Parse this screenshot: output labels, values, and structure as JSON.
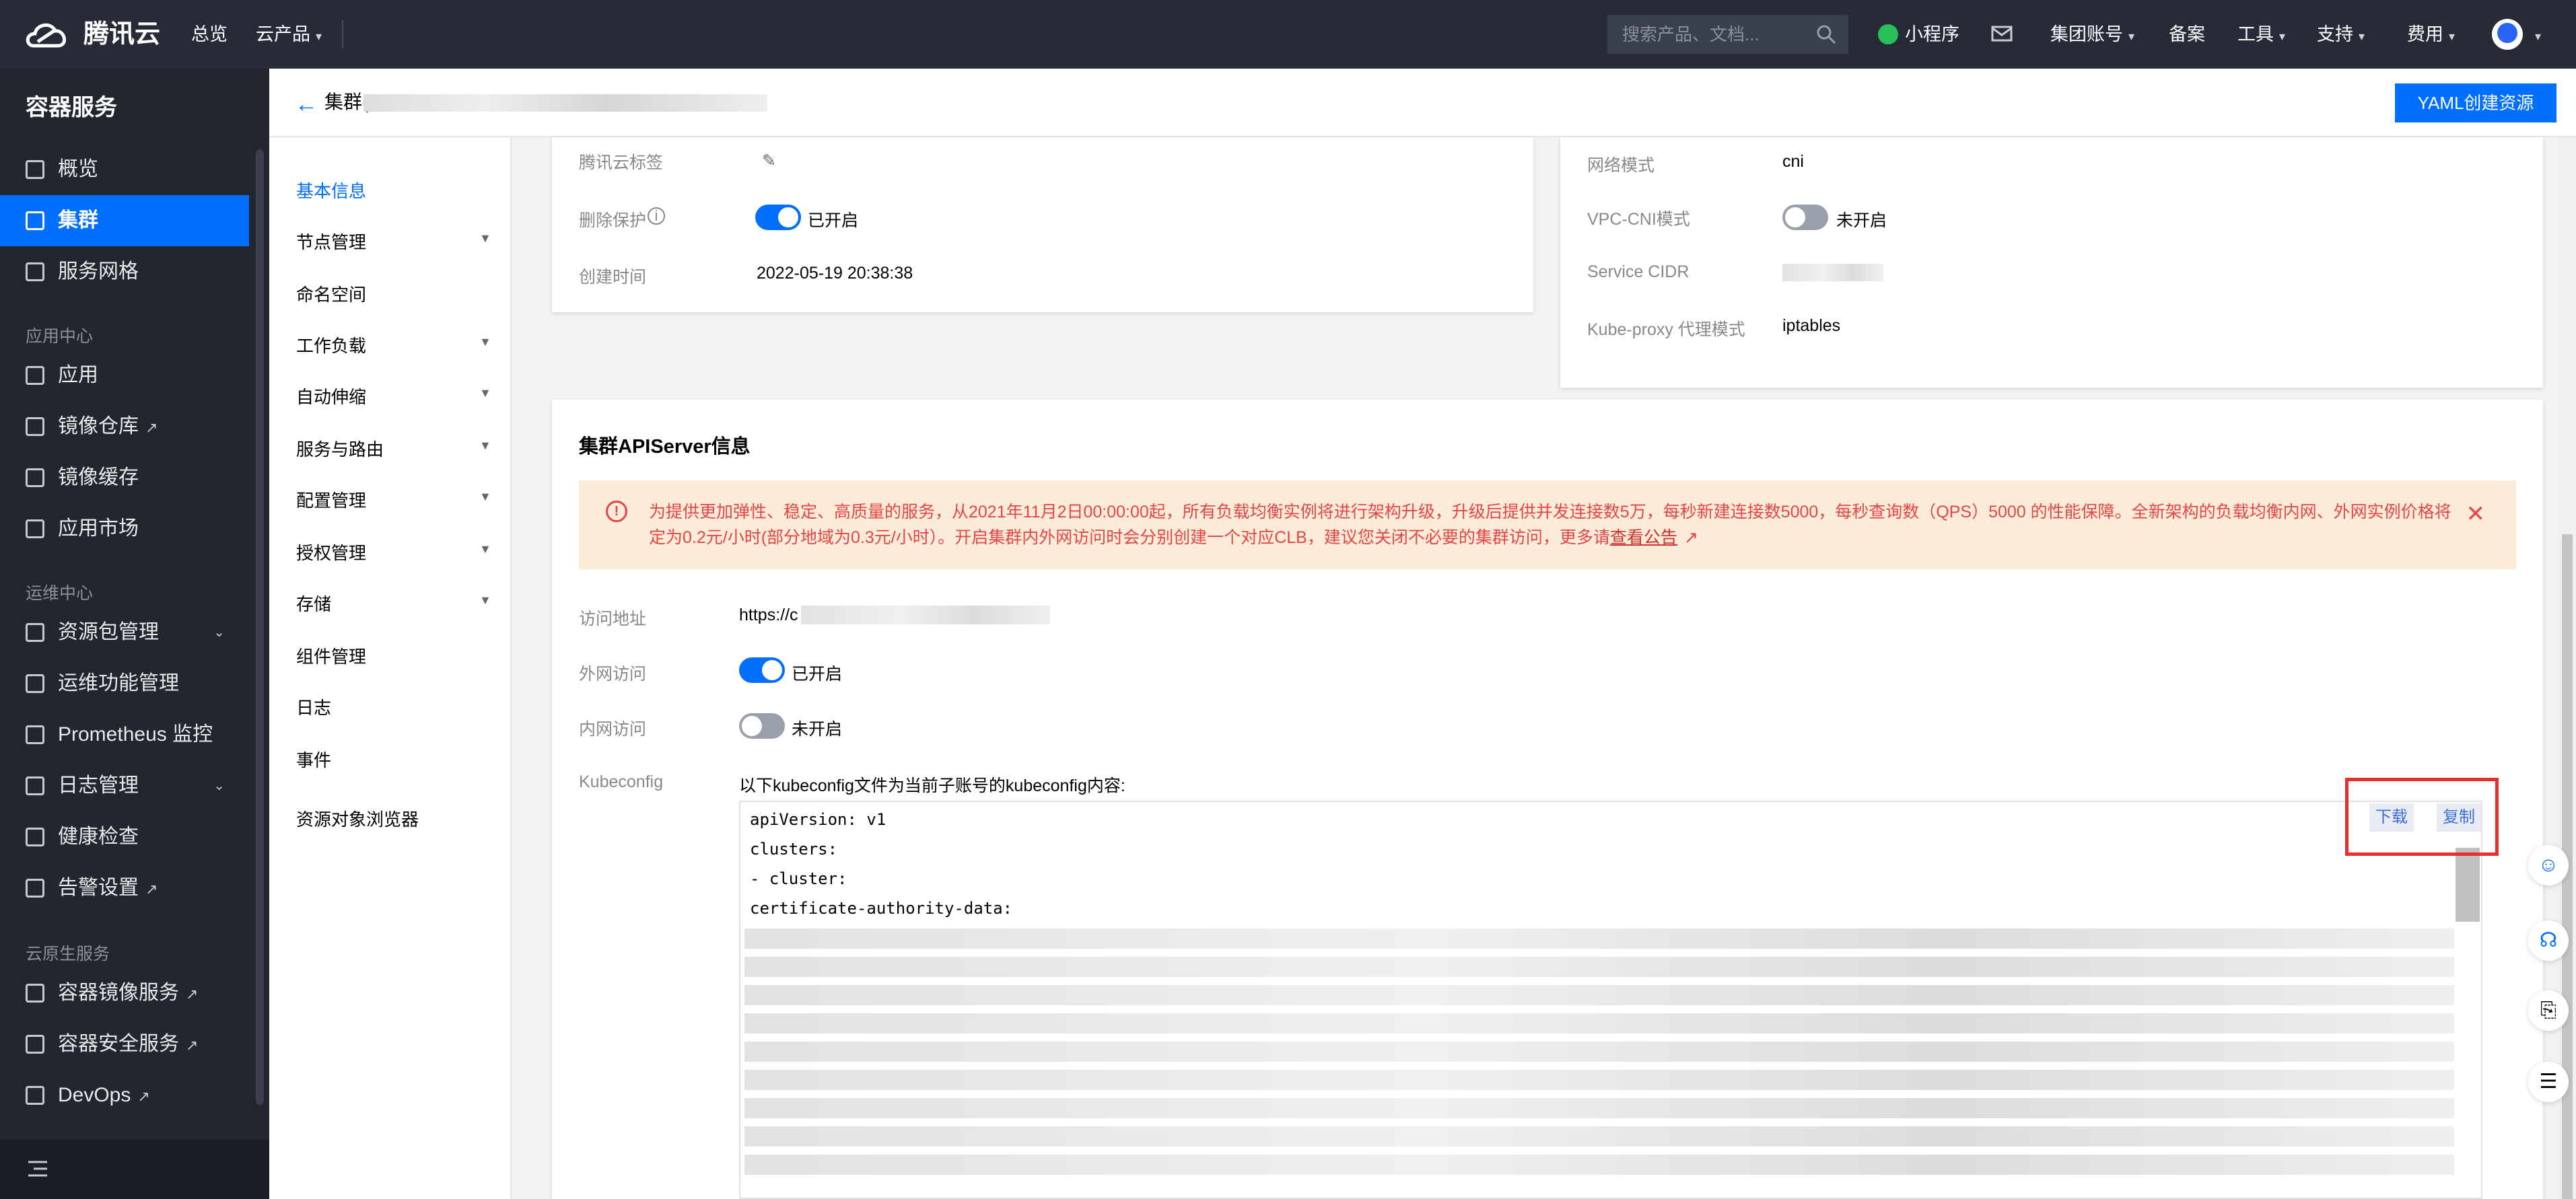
{
  "topnav": {
    "logo": "腾讯云",
    "overview": "总览",
    "products": "云产品",
    "search_placeholder": "搜索产品、文档...",
    "mini_program": "小程序",
    "group_account": "集团账号",
    "filing": "备案",
    "tools": "工具",
    "support": "支持",
    "billing": "费用"
  },
  "sidebar": {
    "title": "容器服务",
    "items": [
      {
        "label": "概览"
      },
      {
        "label": "集群"
      },
      {
        "label": "服务网格"
      }
    ],
    "group_app": "应用中心",
    "app_items": [
      {
        "label": "应用"
      },
      {
        "label": "镜像仓库"
      },
      {
        "label": "镜像缓存"
      },
      {
        "label": "应用市场"
      }
    ],
    "group_ops": "运维中心",
    "ops_items": [
      {
        "label": "资源包管理"
      },
      {
        "label": "运维功能管理"
      },
      {
        "label": "Prometheus 监控"
      },
      {
        "label": "日志管理"
      },
      {
        "label": "健康检查"
      },
      {
        "label": "告警设置"
      }
    ],
    "group_native": "云原生服务",
    "native_items": [
      {
        "label": "容器镜像服务"
      },
      {
        "label": "容器安全服务"
      },
      {
        "label": "DevOps"
      }
    ]
  },
  "header": {
    "crumb": "集群(",
    "yaml_button": "YAML创建资源"
  },
  "submenu": {
    "items": [
      {
        "label": "基本信息"
      },
      {
        "label": "节点管理"
      },
      {
        "label": "命名空间"
      },
      {
        "label": "工作负载"
      },
      {
        "label": "自动伸缩"
      },
      {
        "label": "服务与路由"
      },
      {
        "label": "配置管理"
      },
      {
        "label": "授权管理"
      },
      {
        "label": "存储"
      },
      {
        "label": "组件管理"
      },
      {
        "label": "日志"
      },
      {
        "label": "事件"
      },
      {
        "label": "资源对象浏览器"
      }
    ]
  },
  "basic": {
    "tag_label": "腾讯云标签",
    "delete_protect_label": "删除保护",
    "delete_protect_status": "已开启",
    "created_label": "创建时间",
    "created_value": "2022-05-19 20:38:38"
  },
  "network": {
    "mode_label": "网络模式",
    "mode_value": "cni",
    "vpccni_label": "VPC-CNI模式",
    "vpccni_status": "未开启",
    "cidr_label": "Service CIDR",
    "kubeproxy_label": "Kube-proxy 代理模式",
    "kubeproxy_value": "iptables"
  },
  "apiserver": {
    "title": "集群APIServer信息",
    "notice": "为提供更加弹性、稳定、高质量的服务，从2021年11月2日00:00:00起，所有负载均衡实例将进行架构升级，升级后提供并发连接数5万，每秒新建连接数5000，每秒查询数（QPS）5000 的性能保障。全新架构的负载均衡内网、外网实例价格将定为0.2元/小时(部分地域为0.3元/小时）。开启集群内外网访问时会分别创建一个对应CLB，建议您关闭不必要的集群访问，更多请",
    "notice_link": "查看公告",
    "address_label": "访问地址",
    "address_value": "https://c",
    "public_label": "外网访问",
    "public_status": "已开启",
    "private_label": "内网访问",
    "private_status": "未开启",
    "kubeconfig_label": "Kubeconfig",
    "kubeconfig_desc": "以下kubeconfig文件为当前子账号的kubeconfig内容:",
    "download": "下载",
    "copy": "复制",
    "code": [
      "apiVersion: v1",
      "clusters:",
      "- cluster:",
      "    certificate-authority-data:"
    ]
  },
  "colors": {
    "accent": "#006eff",
    "nav_bg": "#262b37",
    "sidebar_bg": "#21262f",
    "notice_bg": "#fcebd9",
    "notice_text": "#e54545",
    "highlight": "#e53030"
  }
}
